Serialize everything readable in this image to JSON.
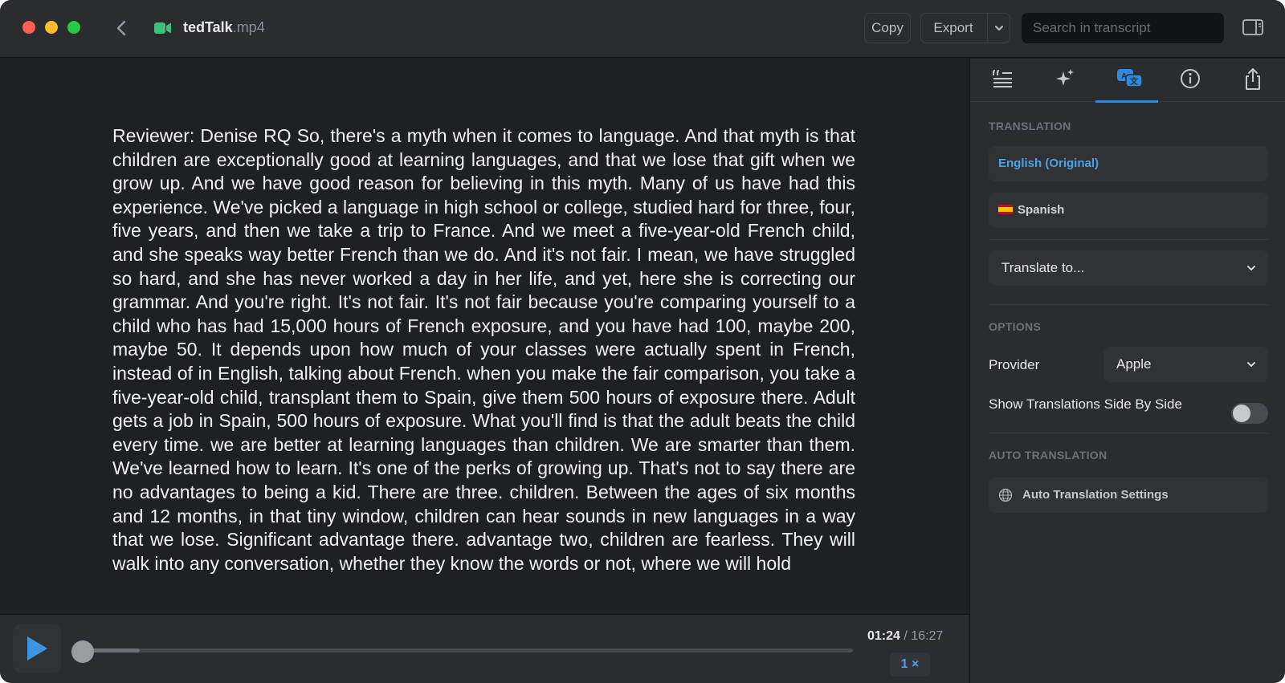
{
  "window": {
    "file_name": "tedTalk",
    "file_ext": ".mp4"
  },
  "toolbar": {
    "copy_label": "Copy",
    "export_label": "Export",
    "search_placeholder": "Search in transcript"
  },
  "transcript": {
    "text": "Reviewer: Denise RQ So, there's a myth when it comes to language. And that myth is that children are exceptionally good at learning languages, and that we lose that gift when we grow up. And we have good reason for believing in this myth. Many of us have had this experience. We've picked a language in high school or college, studied hard for three, four, five years, and then we take a trip to France. And we meet a five-year-old French child, and she speaks way better French than we do. And it's not fair. I mean, we have struggled so hard, and she has never worked a day in her life, and yet, here she is correcting our grammar. And you're right. It's not fair. It's not fair because you're comparing yourself to a child who has had 15,000 hours of French exposure, and you have had 100, maybe 200, maybe 50. It depends upon how much of your classes were actually spent in French, instead of in English, talking about French. when you make the fair comparison, you take a five-year-old child, transplant them to Spain, give them 500 hours of exposure there. Adult gets a job in Spain, 500 hours of exposure. What you'll find is that the adult beats the child every time. we are better at learning languages than children. We are smarter than them. We've learned how to learn. It's one of the perks of growing up. That's not to say there are no advantages to being a kid. There are three. children. Between the ages of six months and 12 months, in that tiny window, children can hear sounds in new languages in a way that we lose. Significant advantage there. advantage two, children are fearless. They will walk into any conversation, whether they know the words or not, where we will hold"
  },
  "player": {
    "current_time": "01:24",
    "separator": " / ",
    "total_time": "16:27",
    "speed": "1 ×",
    "progress": 0.085
  },
  "panel": {
    "tabs": [
      {
        "icon": "quote-list-icon"
      },
      {
        "icon": "sparkles-icon"
      },
      {
        "icon": "translate-icon",
        "active": true
      },
      {
        "icon": "info-icon"
      },
      {
        "icon": "share-icon"
      }
    ],
    "translation_title": "TRANSLATION",
    "languages": [
      {
        "label": "English (Original)"
      },
      {
        "label": "Spanish"
      }
    ],
    "translate_to_label": "Translate to...",
    "options_title": "OPTIONS",
    "provider_label": "Provider",
    "provider_value": "Apple",
    "side_by_side_label": "Show Translations Side By Side",
    "side_by_side_on": false,
    "auto_title": "AUTO TRANSLATION",
    "auto_settings_label": "Auto Translation Settings"
  },
  "colors": {
    "accent": "#2d8ae0",
    "link_blue": "#4aa3e0",
    "background": "#1f2022",
    "panel": "#2b2c2f"
  }
}
